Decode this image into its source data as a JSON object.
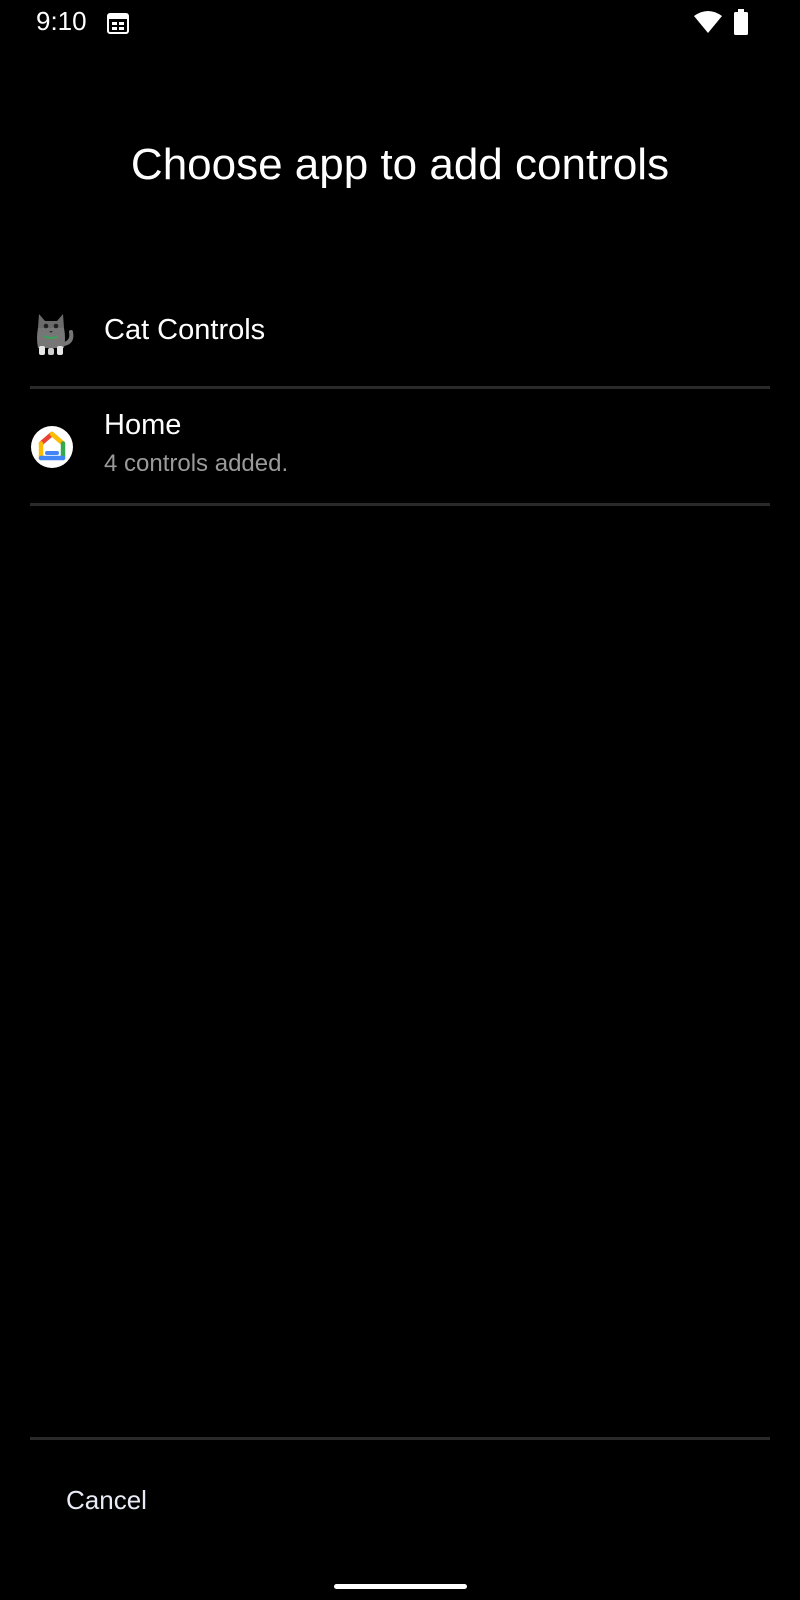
{
  "status_bar": {
    "time": "9:10",
    "icons": [
      "calendar-icon",
      "wifi-icon",
      "battery-icon"
    ]
  },
  "page": {
    "title": "Choose app to add controls"
  },
  "apps": [
    {
      "name": "Cat Controls",
      "subtitle": "",
      "icon": "cat-icon"
    },
    {
      "name": "Home",
      "subtitle": "4 controls added.",
      "icon": "google-home-icon"
    }
  ],
  "footer": {
    "cancel_label": "Cancel"
  },
  "colors": {
    "background": "#000000",
    "text_primary": "#ffffff",
    "text_secondary": "#9a9a9a",
    "divider": "#2a2a2a",
    "home_red": "#ea4335",
    "home_yellow": "#fbbc04",
    "home_green": "#34a853",
    "home_blue": "#4285f4"
  }
}
